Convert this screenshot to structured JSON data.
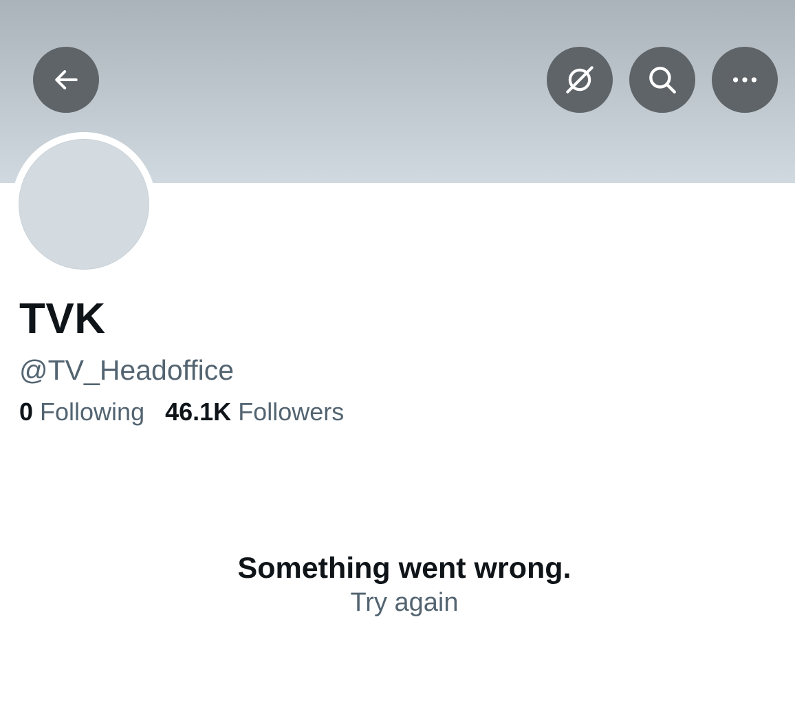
{
  "header": {
    "back_icon": "arrow-left-icon",
    "actions": [
      {
        "name": "grok",
        "icon": "grok-slash-circle-icon"
      },
      {
        "name": "search",
        "icon": "search-icon"
      },
      {
        "name": "more",
        "icon": "more-horizontal-icon"
      }
    ]
  },
  "profile": {
    "display_name": "TVK",
    "handle": "@TV_Headoffice",
    "following_count": "0",
    "following_label": "Following",
    "followers_count": "46.1K",
    "followers_label": "Followers"
  },
  "error": {
    "message": "Something went wrong.",
    "retry_label": "Try again"
  },
  "colors": {
    "text_primary": "#0f1419",
    "text_secondary": "#536471",
    "button_bg": "#5e6468",
    "avatar_placeholder": "#d3dbe0"
  }
}
